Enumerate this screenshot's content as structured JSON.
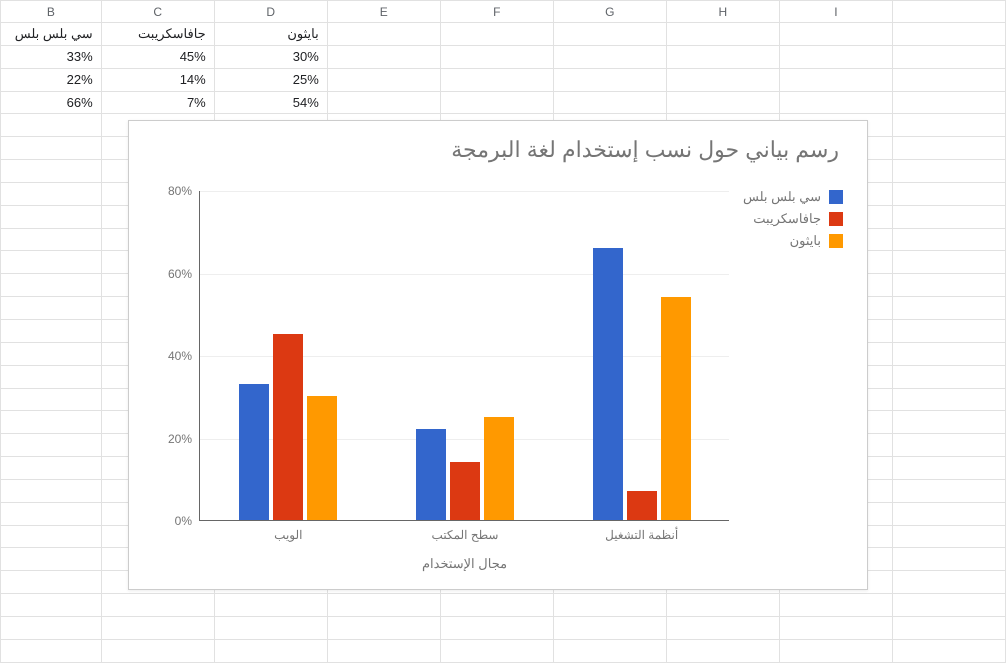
{
  "columns": [
    "B",
    "C",
    "D",
    "E",
    "F",
    "G",
    "H",
    "I"
  ],
  "header_row": {
    "B": "سي بلس بلس",
    "C": "جافاسكريبت",
    "D": "بايثون"
  },
  "data_rows": [
    {
      "B": "33%",
      "C": "45%",
      "D": "30%"
    },
    {
      "B": "22%",
      "C": "14%",
      "D": "25%"
    },
    {
      "B": "66%",
      "C": "7%",
      "D": "54%"
    }
  ],
  "chart_data": {
    "type": "bar",
    "title": "رسم بياني حول نسب إستخدام لغة البرمجة",
    "xlabel": "مجال الإستخدام",
    "ylabel": "",
    "ylim": [
      0,
      80
    ],
    "yticks": [
      0,
      20,
      40,
      60,
      80
    ],
    "ytick_labels": [
      "0%",
      "20%",
      "40%",
      "60%",
      "80%"
    ],
    "categories": [
      "الويب",
      "سطح المكتب",
      "أنظمة التشغيل"
    ],
    "series": [
      {
        "name": "سي بلس بلس",
        "color": "#3366cc",
        "values": [
          33,
          22,
          66
        ]
      },
      {
        "name": "جافاسكريبت",
        "color": "#dc3912",
        "values": [
          45,
          14,
          7
        ]
      },
      {
        "name": "بايثون",
        "color": "#ff9900",
        "values": [
          30,
          25,
          54
        ]
      }
    ],
    "legend_position": "right"
  }
}
